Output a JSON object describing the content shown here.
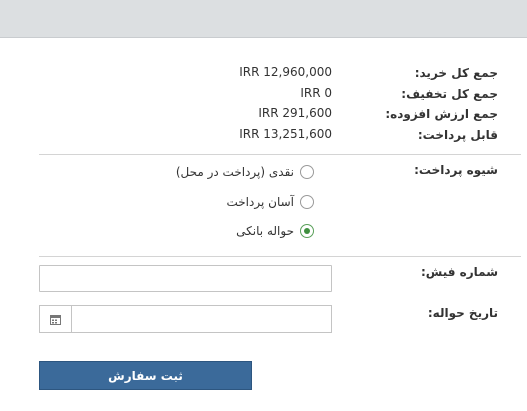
{
  "summary": {
    "total_purchase_label": "جمع کل خرید:",
    "total_purchase_value": "IRR 12,960,000",
    "total_discount_label": "جمع کل تخفیف:",
    "total_discount_value": "IRR 0",
    "total_vat_label": "جمع ارزش افزوده:",
    "total_vat_value": "IRR 291,600",
    "payable_label": "قابل پرداخت:",
    "payable_value": "IRR 13,251,600"
  },
  "payment": {
    "label": "شیوه پرداخت:",
    "options": [
      {
        "label": "نقدی (پرداخت در محل)",
        "selected": false
      },
      {
        "label": "آسان پرداخت",
        "selected": false
      },
      {
        "label": "حواله بانکی",
        "selected": true
      }
    ]
  },
  "form": {
    "receipt_label": "شماره فیش:",
    "receipt_value": "",
    "date_label": "تاریخ حواله:",
    "date_value": ""
  },
  "submit_label": "ثبت سفارش",
  "icons": {
    "calendar": "calendar-icon"
  },
  "colors": {
    "button": "#3b6a9a",
    "radio_selected": "#3f8f3f",
    "topbar": "#dcdfe1"
  }
}
